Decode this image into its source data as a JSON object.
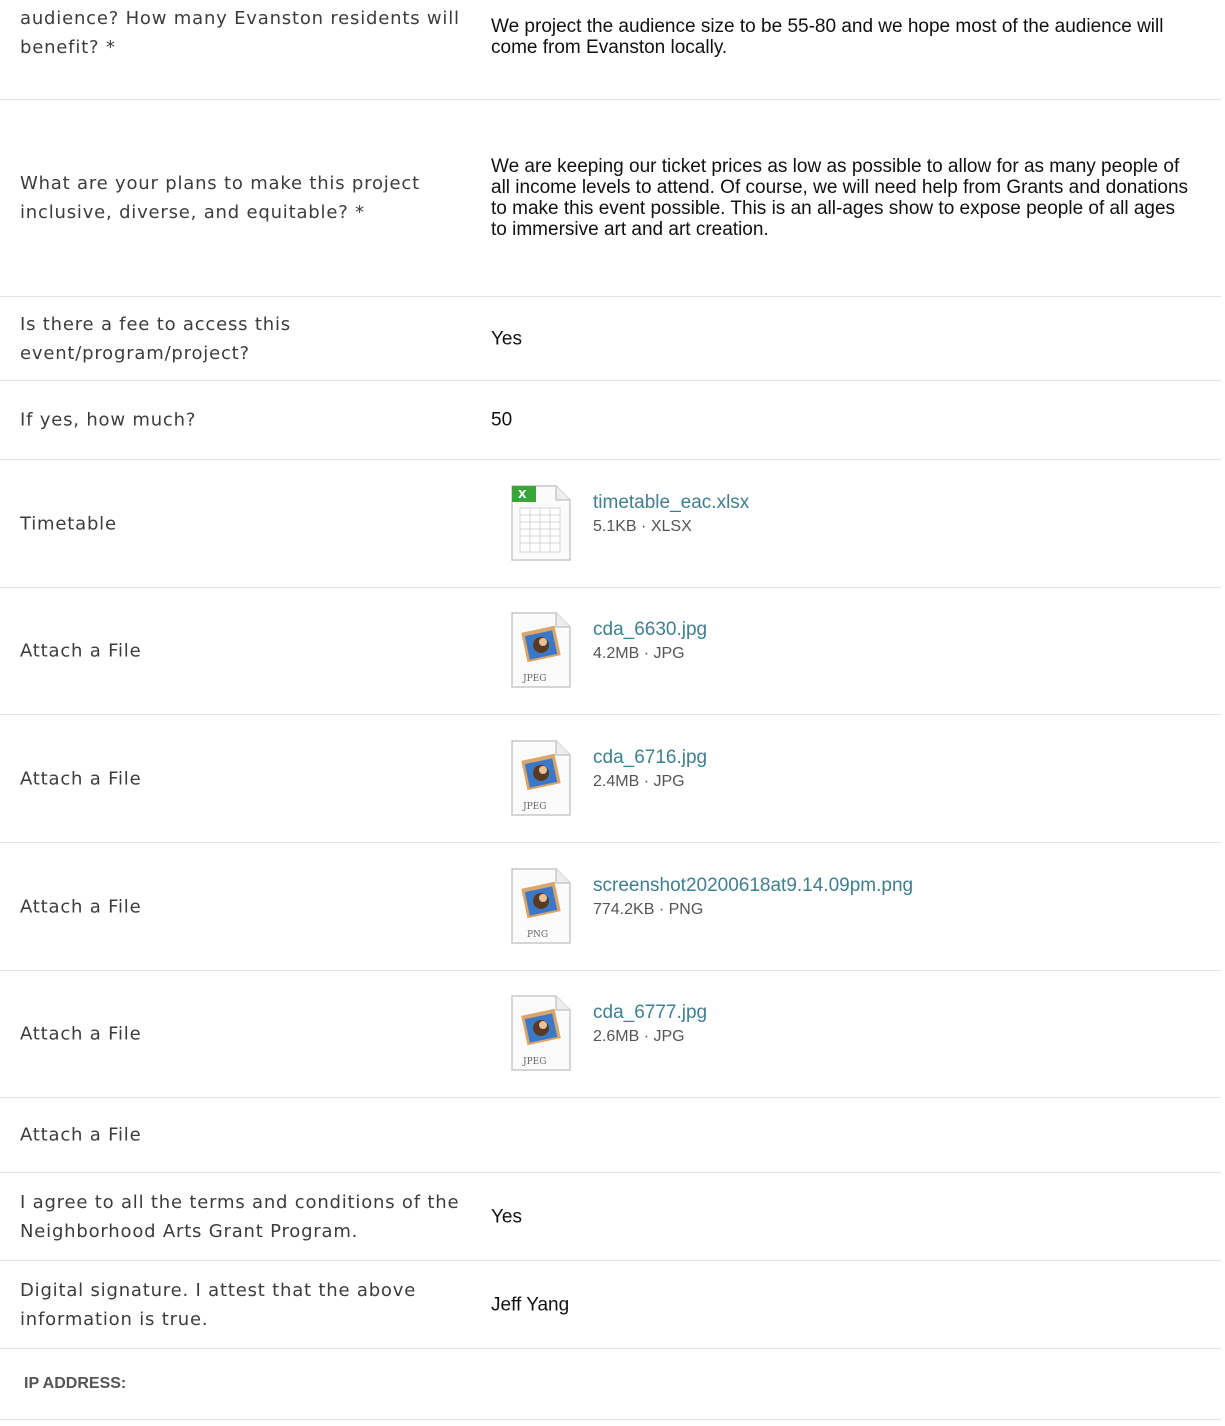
{
  "rows": {
    "audience": {
      "label": "audience? How many Evanston residents will benefit? *",
      "value": "We project the audience size to be 55-80 and we hope most of the audience will come from Evanston locally."
    },
    "inclusive": {
      "label": "What are your plans to make this project inclusive, diverse, and equitable? *",
      "value": "We are keeping our ticket prices as low as possible to allow for as many people of all income levels to attend. Of course, we will need help from Grants and donations to make this event possible. This is an all-ages show to expose people of all ages to immersive art and art creation."
    },
    "fee": {
      "label": "Is there a fee to access this event/program/project?",
      "value": "Yes"
    },
    "how_much": {
      "label": "If yes, how much?",
      "value": "50"
    },
    "timetable": {
      "label": "Timetable",
      "file": {
        "name": "timetable_eac.xlsx",
        "size": "5.1KB",
        "type": "XLSX",
        "icon": "spreadsheet-file-icon"
      }
    },
    "attach1": {
      "label": "Attach a File",
      "file": {
        "name": "cda_6630.jpg",
        "size": "4.2MB",
        "type": "JPG",
        "icon": "image-file-icon",
        "badge": "JPEG"
      }
    },
    "attach2": {
      "label": "Attach a File",
      "file": {
        "name": "cda_6716.jpg",
        "size": "2.4MB",
        "type": "JPG",
        "icon": "image-file-icon",
        "badge": "JPEG"
      }
    },
    "attach3": {
      "label": "Attach a File",
      "file": {
        "name": "screenshot20200618at9.14.09pm.png",
        "size": "774.2KB",
        "type": "PNG",
        "icon": "image-file-icon",
        "badge": "PNG"
      }
    },
    "attach4": {
      "label": "Attach a File",
      "file": {
        "name": "cda_6777.jpg",
        "size": "2.6MB",
        "type": "JPG",
        "icon": "image-file-icon",
        "badge": "JPEG"
      }
    },
    "attach5": {
      "label": "Attach a File"
    },
    "terms": {
      "label": "I agree to all the terms and conditions of the Neighborhood Arts Grant Program.",
      "value": "Yes"
    },
    "signature": {
      "label": "Digital signature. I attest that the above information is true.",
      "value": "Jeff Yang"
    },
    "ip": {
      "label": "IP ADDRESS:"
    }
  },
  "meta_separator": "·",
  "colors": {
    "link": "#3f7f8f",
    "border": "#e3e3e3",
    "label": "#3c3c3c"
  }
}
